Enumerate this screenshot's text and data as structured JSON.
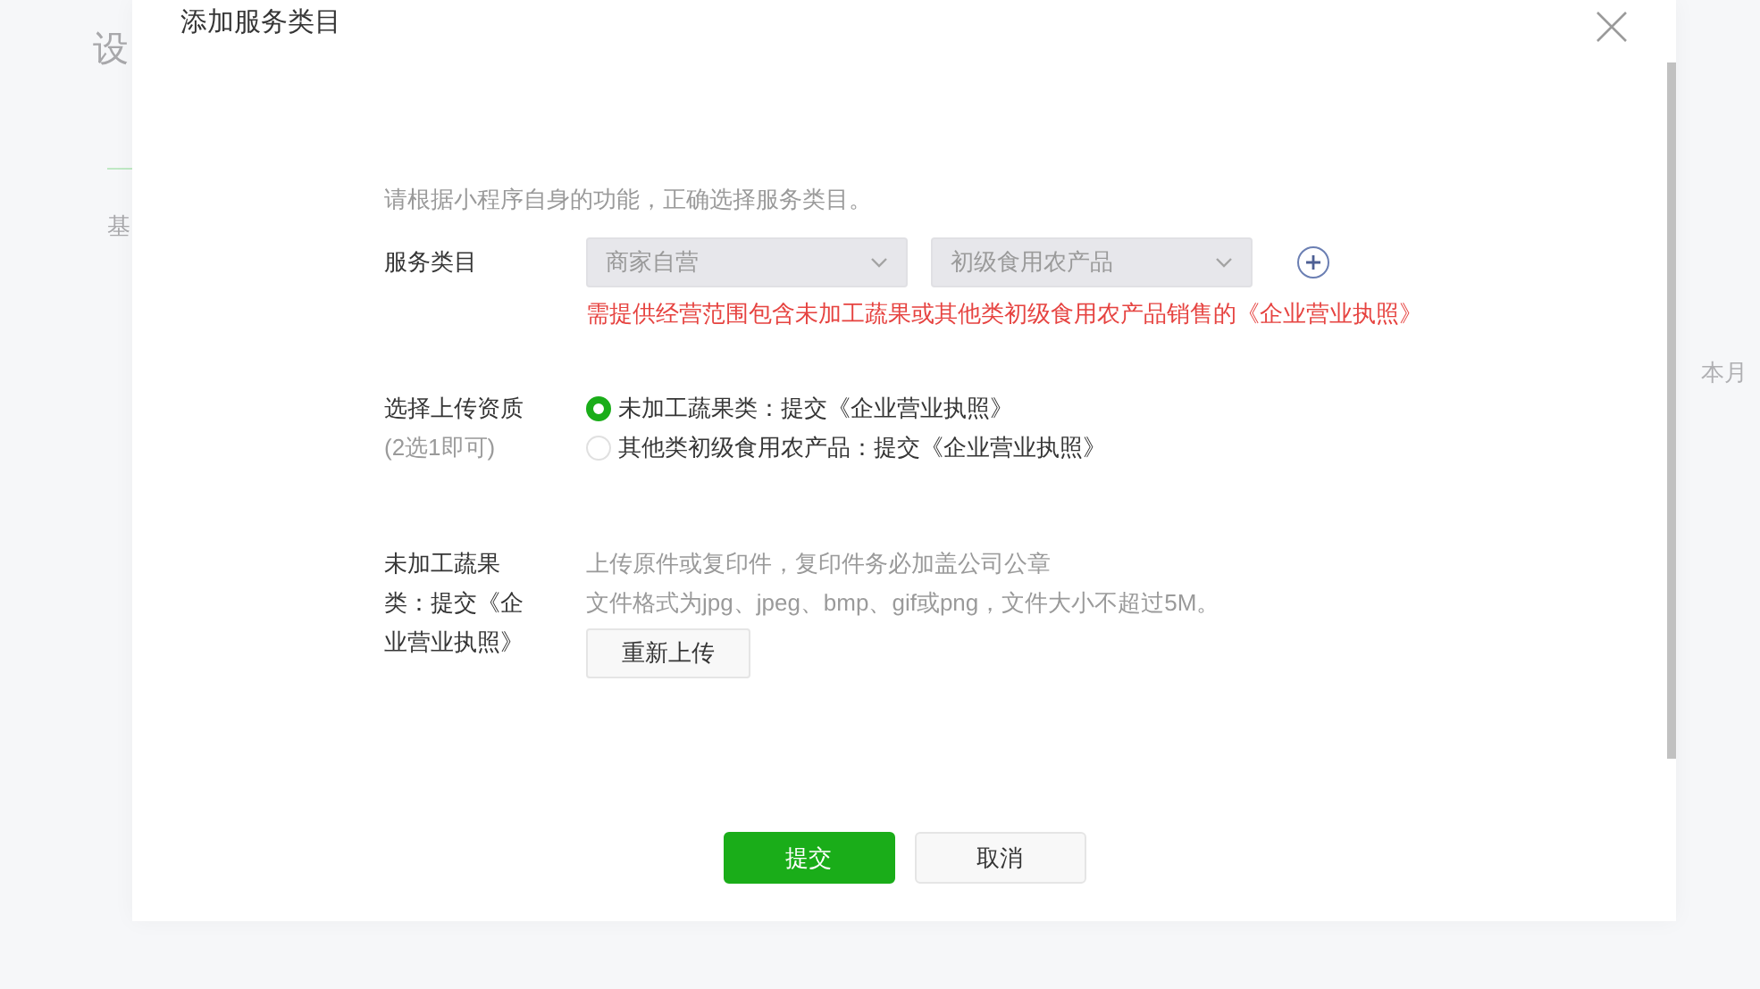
{
  "background_page": {
    "title": "设",
    "tab": "基",
    "side_text": "本月"
  },
  "dialog": {
    "title": "添加服务类目",
    "intro": "请根据小程序自身的功能，正确选择服务类目。",
    "category": {
      "label": "服务类目",
      "selects": [
        {
          "value": "商家自营",
          "disabled": true
        },
        {
          "value": "初级食用农产品",
          "disabled": true
        }
      ],
      "notice": "需提供经营范围包含未加工蔬果或其他类初级食用农产品销售的《企业营业执照》"
    },
    "qualification": {
      "label": "选择上传资质",
      "hint": "(2选1即可)",
      "options": [
        {
          "label": "未加工蔬果类：提交《企业营业执照》",
          "selected": true
        },
        {
          "label": "其他类初级食用农产品：提交《企业营业执照》",
          "selected": false
        }
      ]
    },
    "upload": {
      "label": "未加工蔬果类：提交《企业营业执照》",
      "notes": [
        "上传原件或复印件，复印件务必加盖公司公章",
        "文件格式为jpg、jpeg、bmp、gif或png，文件大小不超过5M。"
      ],
      "button": "重新上传"
    },
    "buttons": [
      {
        "label": "提交",
        "kind": "primary"
      },
      {
        "label": "取消",
        "kind": "default"
      }
    ]
  }
}
